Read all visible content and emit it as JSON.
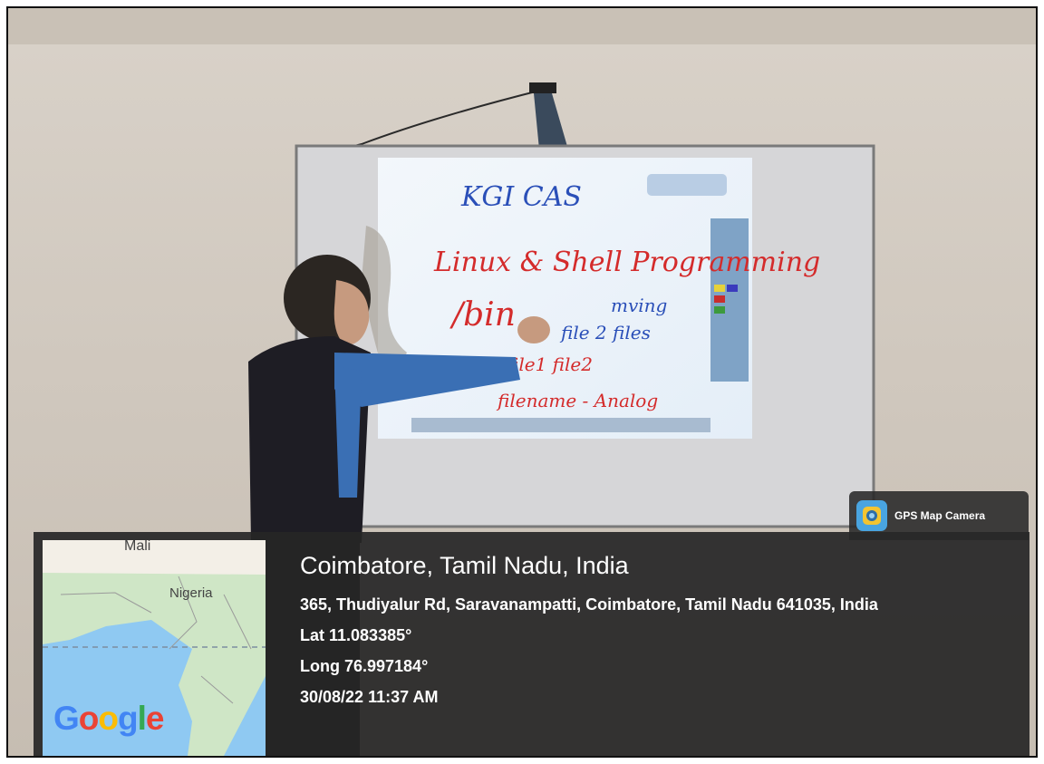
{
  "scene": {
    "board_text": {
      "title": "KGI CAS",
      "heading": "Linux & Shell Programming",
      "bin": "/bin",
      "words": [
        "mving",
        "file 2 files",
        "file1 file2",
        "filename - Analog"
      ]
    }
  },
  "badge": {
    "label": "GPS Map Camera",
    "icon": "camera-app-icon"
  },
  "map": {
    "labels": [
      "Mali",
      "Nigeria"
    ],
    "logo": "Google"
  },
  "location": {
    "city": "Coimbatore, Tamil Nadu, India",
    "address": "365, Thudiyalur Rd, Saravanampatti, Coimbatore, Tamil Nadu 641035, India",
    "lat": "Lat 11.083385°",
    "long": "Long 76.997184°",
    "datetime": "30/08/22 11:37 AM"
  },
  "colors": {
    "overlay": "#262626",
    "wall": "#cfc7bd",
    "screen": "#e8f1fb",
    "red_ink": "#d42b2b",
    "blue_ink": "#2a4fb8"
  }
}
